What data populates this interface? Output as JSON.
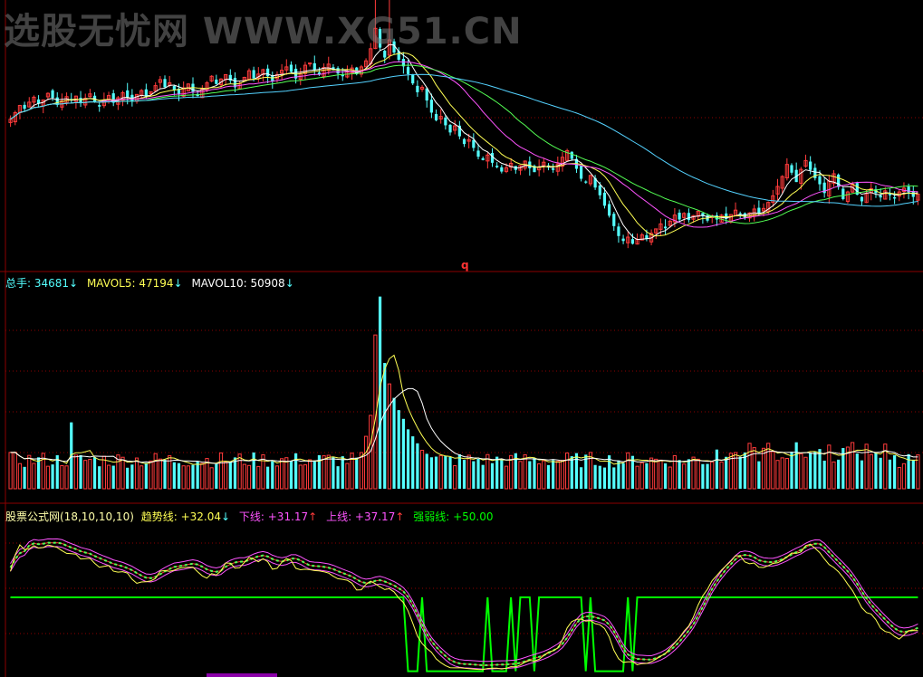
{
  "watermark": "选股无忧网 WWW.XG51.CN",
  "price_marker": "q",
  "volume_panel": {
    "label_total": "总手: ",
    "total_value": "34681",
    "total_arrow": "↓",
    "label_mavol5": "MAVOL5: ",
    "mavol5_value": "47194",
    "mavol5_arrow": "↓",
    "label_mavol10": "MAVOL10: ",
    "mavol10_value": "50908",
    "mavol10_arrow": "↓"
  },
  "indicator_panel": {
    "name": "股票公式网(18,10,10,10)",
    "trend_label": "趋势线: ",
    "trend_value": "+32.04",
    "trend_arrow": "↓",
    "lower_label": "下线: ",
    "lower_value": "+31.17",
    "lower_arrow": "↑",
    "upper_label": "上线: ",
    "upper_value": "+37.17",
    "upper_arrow": "↑",
    "strength_label": "强弱线: ",
    "strength_value": "+50.00"
  },
  "colors": {
    "up": "#ff3b3b",
    "down": "#54ffff",
    "ma5": "#ffffff",
    "ma10": "#ffff54",
    "ma20": "#ff54ff",
    "ma30": "#54ff54",
    "ma60": "#54d2ff",
    "trend": "#ffff54",
    "lower": "#ff54ff",
    "upper": "#ff54ff",
    "strength": "#00ff00",
    "grid": "#8b0000"
  },
  "chart_data": [
    {
      "type": "candlestick",
      "panel": "price",
      "ma_series": [
        "MA5",
        "MA10",
        "MA20",
        "MA30",
        "MA60"
      ],
      "close": [
        62.0,
        63.2,
        64.5,
        63.9,
        65.1,
        66.0,
        64.8,
        65.5,
        66.7,
        65.9,
        64.6,
        65.3,
        66.1,
        65.4,
        66.2,
        64.9,
        65.8,
        66.6,
        65.1,
        64.3,
        65.5,
        66.3,
        65.0,
        65.9,
        66.8,
        66.0,
        65.2,
        66.5,
        67.2,
        66.1,
        67.0,
        68.1,
        69.2,
        67.8,
        68.6,
        67.3,
        66.5,
        67.7,
        68.4,
        67.0,
        66.2,
        67.5,
        68.6,
        69.8,
        68.4,
        69.3,
        70.1,
        69.0,
        67.8,
        68.5,
        69.6,
        70.8,
        69.4,
        70.2,
        71.0,
        69.8,
        68.9,
        70.1,
        70.9,
        71.5,
        70.6,
        69.4,
        70.3,
        71.8,
        72.2,
        70.9,
        70.1,
        71.4,
        72.0,
        71.1,
        70.3,
        69.8,
        70.6,
        71.3,
        70.2,
        71.5,
        72.6,
        74.8,
        78.5,
        75.0,
        73.2,
        76.4,
        74.1,
        72.8,
        71.6,
        70.2,
        68.5,
        66.9,
        67.8,
        65.4,
        63.2,
        61.8,
        62.5,
        60.9,
        59.6,
        60.8,
        58.9,
        57.5,
        58.3,
        56.8,
        55.2,
        54.6,
        55.5,
        54.1,
        53.3,
        52.5,
        53.2,
        54.0,
        52.8,
        53.6,
        54.4,
        53.1,
        52.4,
        53.3,
        54.2,
        53.6,
        52.8,
        53.9,
        55.1,
        56.3,
        54.8,
        53.0,
        51.2,
        50.5,
        51.8,
        49.6,
        48.2,
        46.3,
        44.5,
        42.6,
        40.8,
        39.9,
        40.6,
        39.4,
        40.2,
        41.0,
        40.3,
        41.3,
        42.1,
        43.0,
        42.2,
        43.5,
        44.6,
        43.8,
        44.9,
        43.7,
        44.5,
        45.3,
        44.4,
        43.6,
        44.4,
        43.8,
        44.6,
        43.9,
        44.7,
        45.5,
        44.8,
        44.1,
        45.0,
        45.7,
        44.9,
        45.8,
        46.9,
        48.1,
        49.8,
        51.6,
        53.8,
        52.3,
        50.6,
        52.9,
        54.5,
        52.8,
        51.3,
        50.2,
        48.6,
        50.8,
        52.1,
        49.7,
        47.5,
        48.8,
        50.2,
        48.3,
        47.1,
        48.5,
        49.4,
        48.6,
        47.8,
        49.0,
        48.2,
        47.6,
        48.8,
        49.5,
        48.7,
        47.9,
        48.4
      ]
    },
    {
      "type": "bar",
      "panel": "volume",
      "series": [
        {
          "name": "总手",
          "values": [
            34681
          ]
        },
        {
          "name": "MAVOL5",
          "values": [
            47194
          ]
        },
        {
          "name": "MAVOL10",
          "values": [
            50908
          ]
        }
      ]
    },
    {
      "type": "line",
      "panel": "indicator",
      "title": "股票公式网(18,10,10,10)",
      "params": [
        18,
        10,
        10,
        10
      ],
      "ylim": [
        0,
        100
      ],
      "series": [
        {
          "name": "趋势线",
          "last": 32.04
        },
        {
          "name": "下线",
          "last": 31.17
        },
        {
          "name": "上线",
          "last": 37.17
        },
        {
          "name": "强弱线",
          "last": 50.0
        }
      ]
    }
  ]
}
